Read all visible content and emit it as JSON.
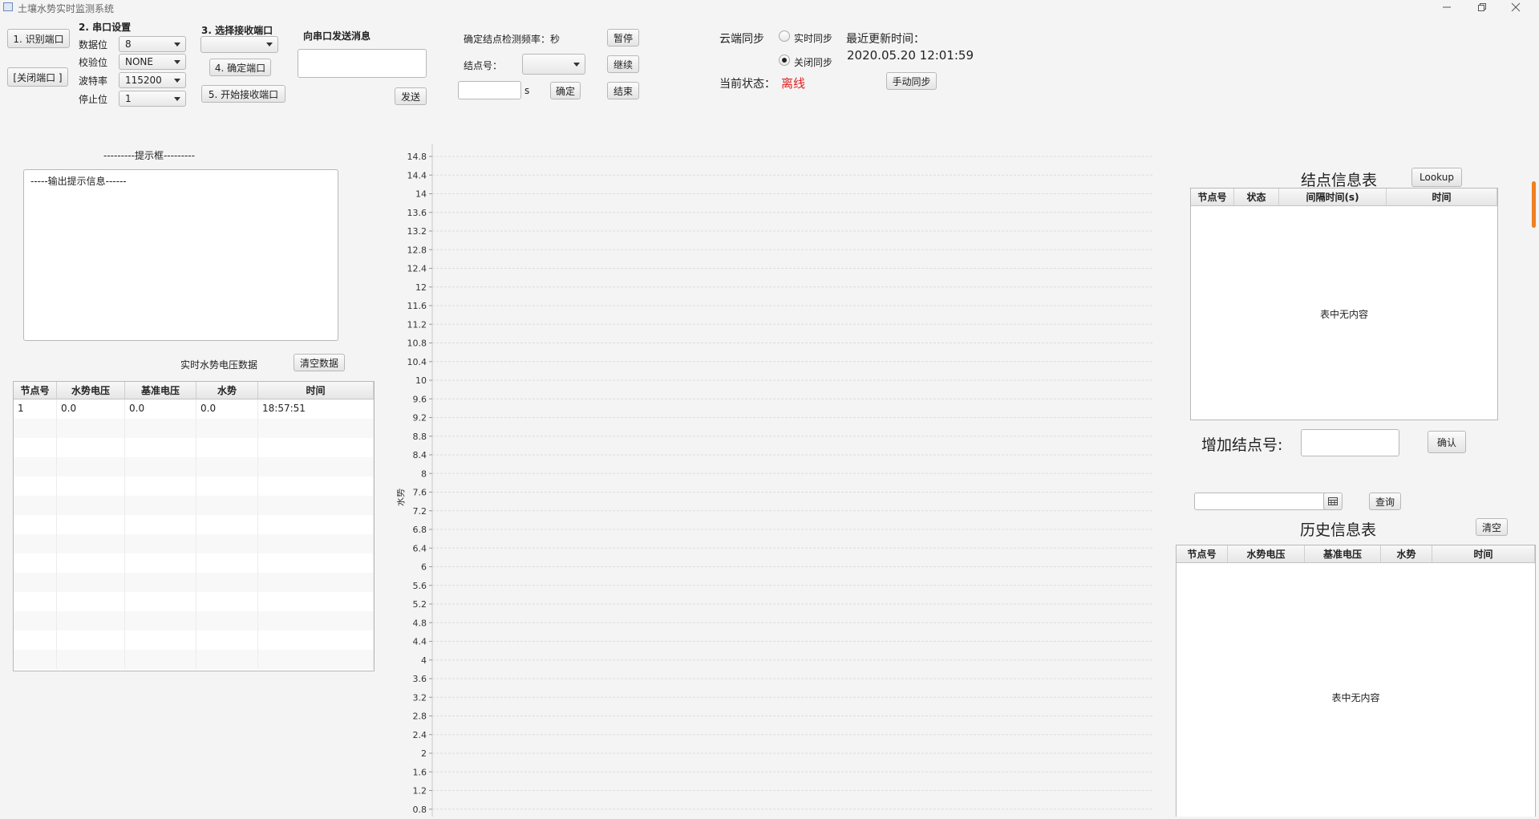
{
  "window": {
    "title": "土壤水势实时监测系统",
    "controls": [
      "minimize-icon",
      "maximize-icon",
      "close-icon"
    ]
  },
  "serial": {
    "identify_button": "1. 识别端口",
    "close_button": "[关闭端口 ]",
    "settings_title": "2. 串口设置",
    "data_bits_label": "数据位",
    "data_bits_value": "8",
    "parity_label": "校验位",
    "parity_value": "NONE",
    "baud_label": "波特率",
    "baud_value": "115200",
    "stop_bits_label": "停止位",
    "stop_bits_value": "1",
    "choose_receive_title": "3. 选择接收端口",
    "choose_receive_value": "",
    "confirm_port_button": "4. 确定端口",
    "start_receive_button": "5. 开始接收端口"
  },
  "send": {
    "title": "向串口发送消息",
    "input_value": "",
    "send_button": "发送"
  },
  "frequency": {
    "title": "确定结点检测频率：秒",
    "node_label": "结点号：",
    "node_value": "",
    "seconds_value": "",
    "seconds_unit": "s",
    "confirm_button": "确定",
    "pause_button": "暂停",
    "resume_button": "继续",
    "end_button": "结束"
  },
  "cloud": {
    "sync_label": "云端同步",
    "realtime_option": "实时同步",
    "close_option": "关闭同步",
    "selected": "关闭同步",
    "last_update_label": "最近更新时间：",
    "last_update_value": "2020.05.20 12:01:59",
    "status_label": "当前状态：",
    "status_value": "离线",
    "status_color": "#e02020",
    "manual_sync_button": "手动同步"
  },
  "prompt": {
    "title": "---------提示框---------",
    "content": "-----输出提示信息------"
  },
  "realtime": {
    "title": "实时水势电压数据",
    "clear_button": "清空数据",
    "columns": [
      "节点号",
      "水势电压",
      "基准电压",
      "水势",
      "时间"
    ],
    "rows": [
      [
        "1",
        "0.0",
        "0.0",
        "0.0",
        "18:57:51"
      ]
    ]
  },
  "chart_data": {
    "type": "line",
    "ylabel": "水势",
    "yticks": [
      "14.8",
      "14.4",
      "14",
      "13.6",
      "13.2",
      "12.8",
      "12.4",
      "12",
      "11.6",
      "11.2",
      "10.8",
      "10.4",
      "10",
      "9.6",
      "9.2",
      "8.8",
      "8.4",
      "8",
      "7.6",
      "7.2",
      "6.8",
      "6.4",
      "6",
      "5.6",
      "5.2",
      "4.8",
      "4.4",
      "4",
      "3.6",
      "3.2",
      "2.8",
      "2.4",
      "2",
      "1.6",
      "1.2",
      "0.8"
    ],
    "series": [],
    "grid": true
  },
  "node_table": {
    "title": "结点信息表",
    "lookup_button": "Lookup",
    "columns": [
      "节点号",
      "状态",
      "间隔时间(s)",
      "时间"
    ],
    "empty_text": "表中无内容",
    "add_label": "增加结点号:",
    "add_value": "",
    "confirm_button": "确认"
  },
  "history": {
    "date_value": "",
    "query_button": "查询",
    "title": "历史信息表",
    "clear_button": "清空",
    "columns": [
      "节点号",
      "水势电压",
      "基准电压",
      "水势",
      "时间"
    ],
    "empty_text": "表中无内容"
  }
}
